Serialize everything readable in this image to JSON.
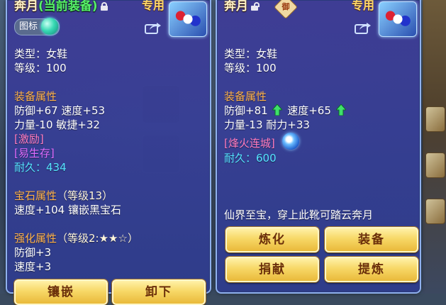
{
  "left_panel": {
    "item_name": "奔月",
    "equipped_tag": "(当前装备)",
    "exclusive_label": "专用",
    "icon_toggle_label": "图标",
    "type_line": "类型：女鞋",
    "level_line": "等级：100",
    "equip_attr_header": "装备属性",
    "attr_line_1": "防御+67 速度+53",
    "attr_line_2": "力量-10 敏捷+32",
    "special_1": "[激励]",
    "special_2": "[易生存]",
    "durability": "耐久：434",
    "gem_header": "宝石属性",
    "gem_level": "（等级13）",
    "gem_line": "速度+104 镶嵌黑宝石",
    "enhance_header": "强化属性",
    "enhance_level": "（等级2:★★☆）",
    "enhance_line_1": "防御+3",
    "enhance_line_2": "速度+3",
    "button_inlay": "镶嵌",
    "button_unequip": "卸下"
  },
  "right_panel": {
    "item_name": "奔月",
    "seal_char": "御",
    "exclusive_label": "专用",
    "type_line": "类型：女鞋",
    "level_line": "等级：100",
    "equip_attr_header": "装备属性",
    "attr_defense": "防御+81",
    "attr_speed": "速度+65",
    "attr_line_2": "力量-13 耐力+33",
    "special_1": "[烽火连城]",
    "durability": "耐久：600",
    "description": "仙界至宝，穿上此靴可踏云奔月",
    "button_refine": "炼化",
    "button_equip": "装备",
    "button_donate": "捐献",
    "button_extract": "提炼"
  },
  "icons": {
    "lock": "lock-icon",
    "unlock": "unlock-icon",
    "share": "share-icon",
    "upgrade_arrow": "green-up-arrow-icon"
  },
  "colors": {
    "panel_bg": "#3e3a96",
    "title": "#fff3c8",
    "equipped_tag": "#57f06a",
    "section_header": "#ffb24a",
    "special_pink": "#ff7cc0",
    "special_violet": "#e06cff",
    "durability": "#55e4ff",
    "button_gold": "#f7d867"
  }
}
